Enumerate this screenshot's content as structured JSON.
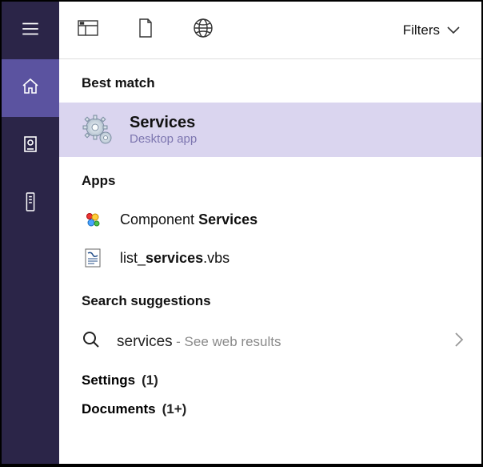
{
  "sidebar": {
    "items": [
      {
        "name": "hamburger-menu-icon",
        "active": false
      },
      {
        "name": "home-icon",
        "active": true
      },
      {
        "name": "documents-icon",
        "active": false
      },
      {
        "name": "remote-icon",
        "active": false
      }
    ]
  },
  "toolbar": {
    "icons": [
      {
        "name": "apps-view-icon"
      },
      {
        "name": "document-icon"
      },
      {
        "name": "web-icon"
      }
    ],
    "filters_label": "Filters"
  },
  "sections": {
    "best_match": {
      "header": "Best match",
      "item": {
        "title": "Services",
        "subtitle": "Desktop app",
        "icon": "gear-services-icon"
      }
    },
    "apps": {
      "header": "Apps",
      "items": [
        {
          "icon": "component-services-icon",
          "pre": "Component ",
          "bold": "Services",
          "post": ""
        },
        {
          "icon": "script-file-icon",
          "pre": "list_",
          "bold": "services",
          "post": ".vbs"
        }
      ]
    },
    "search_suggestions": {
      "header": "Search suggestions",
      "item": {
        "query": "services",
        "hint": "See web results"
      }
    },
    "groups": [
      {
        "name": "Settings",
        "count": "(1)"
      },
      {
        "name": "Documents",
        "count": "(1+)"
      }
    ]
  }
}
